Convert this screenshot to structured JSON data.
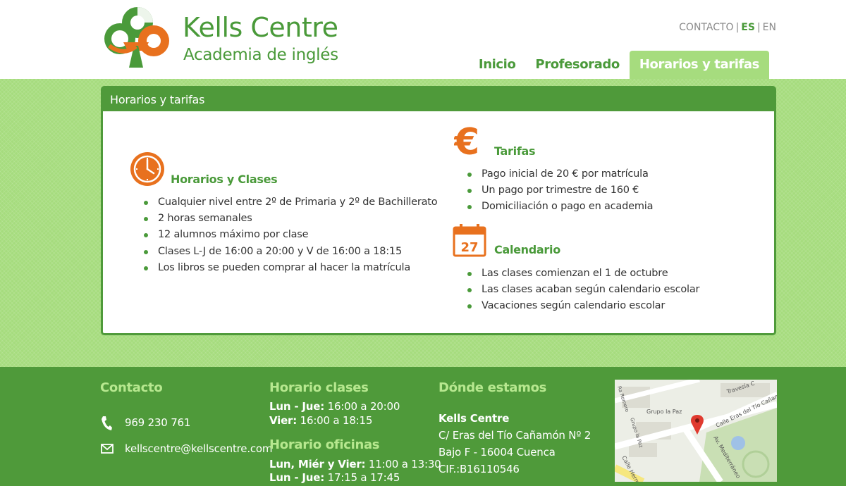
{
  "brand": {
    "title": "Kells Centre",
    "subtitle": "Academia de inglés"
  },
  "toplinks": {
    "contact": "CONTACTO",
    "sep": "|",
    "lang_es": "ES",
    "lang_en": "EN"
  },
  "nav": {
    "items": [
      {
        "label": "Inicio"
      },
      {
        "label": "Profesorado"
      },
      {
        "label": "Horarios y tarifas",
        "active": true
      }
    ]
  },
  "panel": {
    "title": "Horarios y tarifas",
    "horarios": {
      "title": "Horarios y Clases",
      "items": [
        "Cualquier nivel entre 2º de Primaria y 2º de Bachillerato",
        "2 horas semanales",
        "12 alumnos máximo por clase",
        "Clases L-J de 16:00 a 20:00 y V de 16:00 a 18:15",
        "Los libros se pueden comprar al hacer la matrícula"
      ]
    },
    "tarifas": {
      "title": "Tarifas",
      "items": [
        "Pago inicial de 20 € por matrícula",
        "Un pago por trimestre de 160 €",
        "Domiciliación o pago en academia"
      ]
    },
    "calendario": {
      "title": "Calendario",
      "day": "27",
      "items": [
        "Las clases comienzan el 1 de octubre",
        "Las clases acaban según calendario escolar",
        "Vacaciones según calendario escolar"
      ]
    }
  },
  "footer": {
    "contacto": {
      "title": "Contacto",
      "phone": "969 230 761",
      "email": "kellscentre@kellscentre.com"
    },
    "horario_clases": {
      "title": "Horario clases",
      "line1_label": "Lun - Jue:",
      "line1_value": " 16:00 a 20:00",
      "line2_label": "Vier:",
      "line2_value": " 16:00 a 18:15"
    },
    "horario_oficinas": {
      "title": "Horario oficinas",
      "line1_label": "Lun, Miér y Vier:",
      "line1_value": " 11:00 a 13:30",
      "line2_label": "Lun - Jue:",
      "line2_value": " 17:15 a 17:45"
    },
    "donde": {
      "title": "Dónde estamos",
      "name": "Kells Centre",
      "address1": "C/ Eras del Tío Cañamón Nº 2",
      "address2": "Bajo F - 16004 Cuenca",
      "cif": "CIF.:B16110546"
    },
    "map_labels": {
      "street1": "Calle Eras del Tío Cañamón",
      "street2": "Av. Mediterráneo",
      "street3": "Grupo la Paz",
      "street4": "Travesía C",
      "street5": "Calle Herm",
      "street6": "Grupo la Paz",
      "street7": "Ra Romero"
    }
  },
  "colors": {
    "green": "#4a9a3a",
    "light_green": "#a6dc7e",
    "orange": "#e8711e",
    "footer_title": "#b7e88f"
  }
}
